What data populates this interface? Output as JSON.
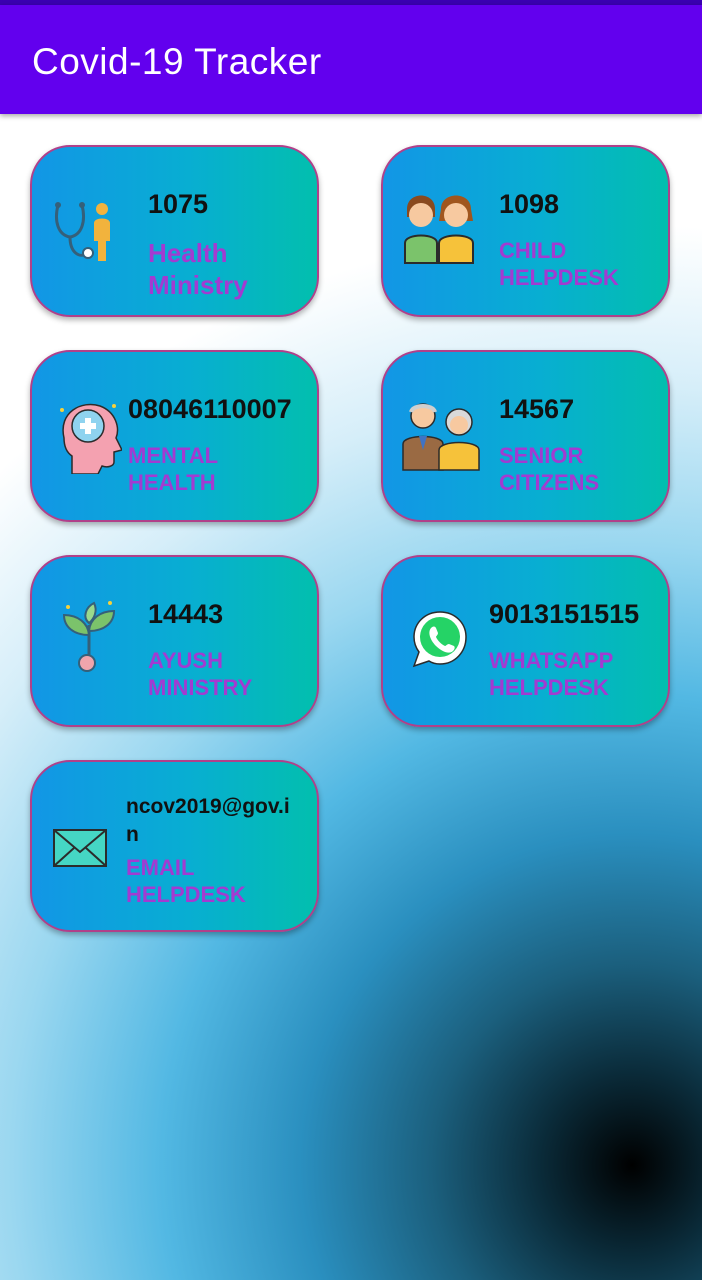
{
  "app": {
    "title": "Covid-19 Tracker"
  },
  "cards": [
    {
      "number": "1075",
      "label": "Health Ministry",
      "icon": "doctor-stethoscope-icon"
    },
    {
      "number": "1098",
      "label": "CHILD HELPDESK",
      "icon": "children-icon"
    },
    {
      "number": "08046110007",
      "label": "MENTAL HEALTH",
      "icon": "mental-health-head-icon"
    },
    {
      "number": "14567",
      "label": "SENIOR CITIZENS",
      "icon": "senior-couple-icon"
    },
    {
      "number": "14443",
      "label": "AYUSH MINISTRY",
      "icon": "herbal-plant-icon"
    },
    {
      "number": "9013151515",
      "label": "WHATSAPP HELPDESK",
      "icon": "whatsapp-icon"
    },
    {
      "number": "ncov2019@gov.in",
      "label": "EMAIL HELPDESK",
      "icon": "envelope-icon"
    }
  ],
  "colors": {
    "appbar": "#6200ee",
    "status_strip": "#3a00b0",
    "card_gradient_start": "#1296e6",
    "card_gradient_end": "#02bfae",
    "card_border": "#b0408a",
    "label_text": "#a23bd1",
    "number_text": "#111111"
  }
}
